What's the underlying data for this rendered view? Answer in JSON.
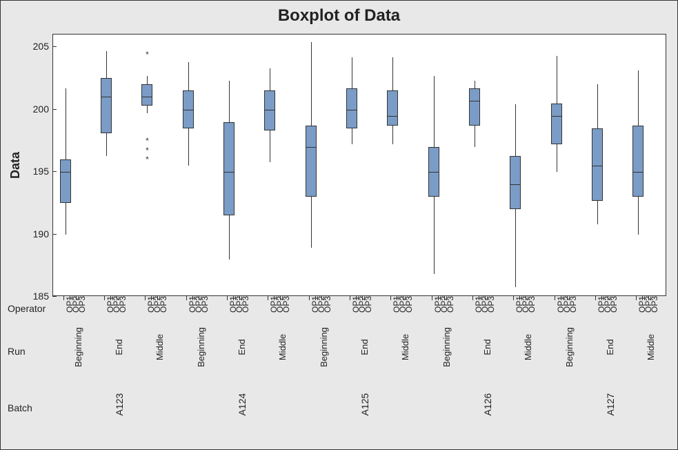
{
  "title": "Boxplot of Data",
  "ylabel": "Data",
  "row_labels": {
    "operator": "Operator",
    "run": "Run",
    "batch": "Batch"
  },
  "y_ticks": [
    185,
    190,
    195,
    200,
    205
  ],
  "ylim": [
    185,
    206
  ],
  "chart_data": {
    "type": "boxplot",
    "title": "Boxplot of Data",
    "xlabel": "",
    "ylabel": "Data",
    "ylim": [
      185,
      206
    ],
    "operators": [
      "OP1",
      "OP2",
      "OP3"
    ],
    "runs": [
      "Beginning",
      "End",
      "Middle"
    ],
    "batches": [
      "A123",
      "A124",
      "A125",
      "A126",
      "A127"
    ],
    "series": [
      {
        "batch": "A123",
        "run": "Beginning",
        "op": "OP1",
        "low": 190.0,
        "q1": 192.5,
        "med": 195.0,
        "q3": 196.0,
        "high": 201.7,
        "outliers": []
      },
      {
        "batch": "A123",
        "run": "End",
        "op": "OP1",
        "low": 196.3,
        "q1": 198.1,
        "med": 201.0,
        "q3": 202.5,
        "high": 204.7,
        "outliers": []
      },
      {
        "batch": "A123",
        "run": "Middle",
        "op": "OP1",
        "low": 199.7,
        "q1": 200.3,
        "med": 201.0,
        "q3": 202.0,
        "high": 202.7,
        "outliers": [
          204.4,
          197.5,
          196.7,
          196.0
        ]
      },
      {
        "batch": "A124",
        "run": "Beginning",
        "op": "OP1",
        "low": 195.5,
        "q1": 198.5,
        "med": 200.0,
        "q3": 201.5,
        "high": 203.8,
        "outliers": []
      },
      {
        "batch": "A124",
        "run": "End",
        "op": "OP1",
        "low": 188.0,
        "q1": 191.5,
        "med": 195.0,
        "q3": 199.0,
        "high": 202.3,
        "outliers": []
      },
      {
        "batch": "A124",
        "run": "Middle",
        "op": "OP1",
        "low": 195.8,
        "q1": 198.3,
        "med": 200.0,
        "q3": 201.5,
        "high": 203.3,
        "outliers": []
      },
      {
        "batch": "A125",
        "run": "Beginning",
        "op": "OP1",
        "low": 188.9,
        "q1": 193.0,
        "med": 197.0,
        "q3": 198.7,
        "high": 205.4,
        "outliers": []
      },
      {
        "batch": "A125",
        "run": "End",
        "op": "OP1",
        "low": 197.2,
        "q1": 198.5,
        "med": 200.0,
        "q3": 201.7,
        "high": 204.2,
        "outliers": []
      },
      {
        "batch": "A125",
        "run": "Middle",
        "op": "OP1",
        "low": 197.2,
        "q1": 198.7,
        "med": 199.5,
        "q3": 201.5,
        "high": 204.2,
        "outliers": []
      },
      {
        "batch": "A126",
        "run": "Beginning",
        "op": "OP1",
        "low": 186.8,
        "q1": 193.0,
        "med": 195.0,
        "q3": 197.0,
        "high": 202.7,
        "outliers": []
      },
      {
        "batch": "A126",
        "run": "End",
        "op": "OP1",
        "low": 197.0,
        "q1": 198.7,
        "med": 200.7,
        "q3": 201.7,
        "high": 202.3,
        "outliers": []
      },
      {
        "batch": "A126",
        "run": "Middle",
        "op": "OP1",
        "low": 185.8,
        "q1": 192.0,
        "med": 194.0,
        "q3": 196.3,
        "high": 200.4,
        "outliers": []
      },
      {
        "batch": "A127",
        "run": "Beginning",
        "op": "OP1",
        "low": 195.0,
        "q1": 197.2,
        "med": 199.5,
        "q3": 200.5,
        "high": 204.3,
        "outliers": []
      },
      {
        "batch": "A127",
        "run": "End",
        "op": "OP1",
        "low": 190.8,
        "q1": 192.7,
        "med": 195.5,
        "q3": 198.5,
        "high": 202.0,
        "outliers": []
      },
      {
        "batch": "A127",
        "run": "Middle",
        "op": "OP1",
        "low": 190.0,
        "q1": 193.0,
        "med": 195.0,
        "q3": 198.7,
        "high": 203.1,
        "outliers": []
      }
    ]
  }
}
